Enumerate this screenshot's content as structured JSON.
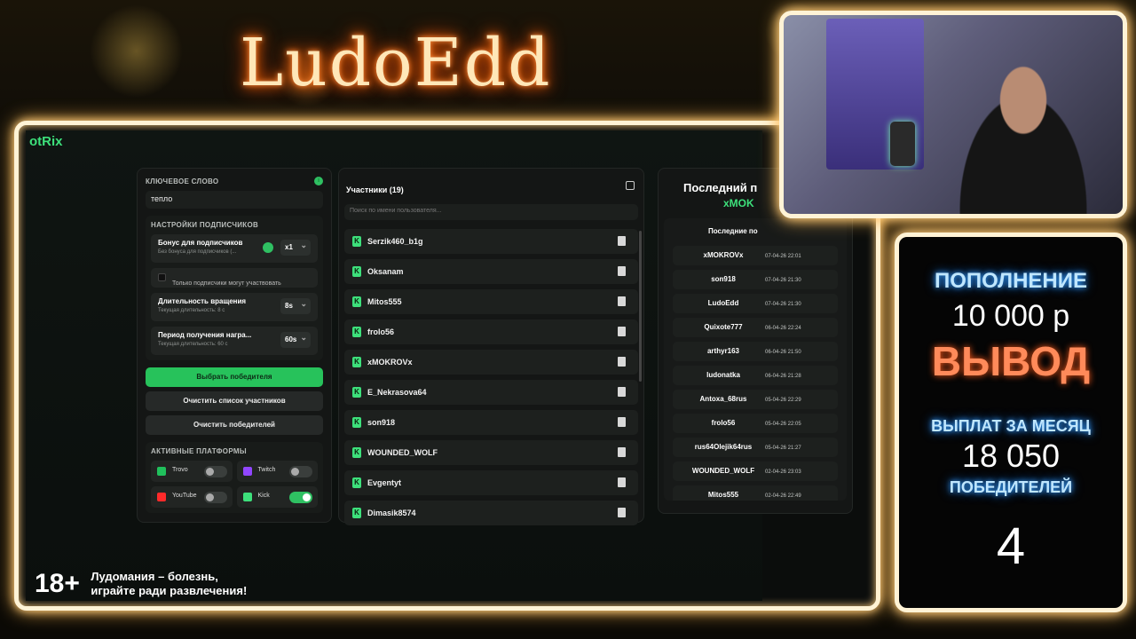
{
  "logo_text": "LudoEdd",
  "app": {
    "brand": "otRix",
    "keyword": {
      "label": "КЛЮЧЕВОЕ СЛОВО",
      "value": "тепло"
    },
    "sub_settings": {
      "title": "НАСТРОЙКИ ПОДПИСЧИКОВ",
      "bonus": {
        "title": "Бонус для подписчиков",
        "sub": "Без бонуса для подписчиков (...",
        "value": "x1"
      },
      "only_subs": "Только подписчики могут участвовать",
      "spin": {
        "title": "Длительность вращения",
        "sub": "Текущая длительность: 8 с",
        "value": "8s"
      },
      "reward": {
        "title": "Период получения награ...",
        "sub": "Текущая длительность: 60 с",
        "value": "60s"
      }
    },
    "buttons": {
      "pick": "Выбрать победителя",
      "clear_participants": "Очистить список участников",
      "clear_winners": "Очистить победителей"
    },
    "platforms": {
      "title": "АКТИВНЫЕ ПЛАТФОРМЫ",
      "items": [
        {
          "name": "Trovo",
          "color": "#20c05c",
          "on": false
        },
        {
          "name": "Twitch",
          "color": "#9146ff",
          "on": false
        },
        {
          "name": "YouTube",
          "color": "#ff2a2a",
          "on": false
        },
        {
          "name": "Kick",
          "color": "#3de07b",
          "on": true
        }
      ]
    },
    "participants": {
      "title": "Участники (19)",
      "search_placeholder": "Поиск по имени пользователя...",
      "list": [
        "Serzik460_b1g",
        "Oksanam",
        "Mitos555",
        "frolo56",
        "xMOKROVx",
        "E_Nekrasova64",
        "son918",
        "WOUNDED_WOLF",
        "Evgentyt",
        "Dimasik8574"
      ]
    },
    "winner": {
      "title": "Последний п",
      "name": "xMOK",
      "recent_header": "Последние по",
      "list": [
        {
          "name": "xMOKROVx",
          "date": "07-04-26 22:01"
        },
        {
          "name": "son918",
          "date": "07-04-26 21:30"
        },
        {
          "name": "LudoEdd",
          "date": "07-04-26 21:30"
        },
        {
          "name": "Quixote777",
          "date": "06-04-26 22:24"
        },
        {
          "name": "arthyr163",
          "date": "06-04-26 21:50"
        },
        {
          "name": "ludonatka",
          "date": "06-04-26 21:28"
        },
        {
          "name": "Antoxa_68rus",
          "date": "05-04-26 22:29"
        },
        {
          "name": "frolo56",
          "date": "05-04-26 22:05"
        },
        {
          "name": "rus64Olejik64rus",
          "date": "05-04-26 21:27"
        },
        {
          "name": "WOUNDED_WOLF",
          "date": "02-04-26 23:03"
        },
        {
          "name": "Mitos555",
          "date": "02-04-26 22:49"
        }
      ]
    }
  },
  "warning": {
    "age": "18+",
    "line1": "Лудомания – болезнь,",
    "line2": "играйте ради развлечения!"
  },
  "stats": {
    "deposit_label": "ПОПОЛНЕНИЕ",
    "deposit_value": "10 000 р",
    "withdraw_label": "ВЫВОД",
    "month_label": "ВЫПЛАТ ЗА МЕСЯЦ",
    "month_value": "18 050",
    "winners_label": "ПОБЕДИТЕЛЕЙ",
    "winners_value": "4"
  }
}
